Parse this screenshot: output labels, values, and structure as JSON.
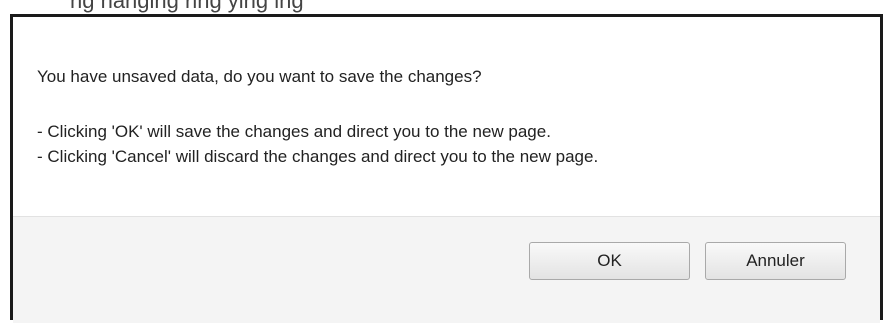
{
  "background_header": {
    "text": "ng  hanging  ring  ying  ing"
  },
  "dialog": {
    "message": "You have unsaved data, do you want to save the changes?",
    "detail_lines": [
      "- Clicking 'OK' will save the changes and direct you to the new page.",
      "- Clicking 'Cancel' will discard the changes and direct you to the new page."
    ],
    "buttons": {
      "ok_label": "OK",
      "cancel_label": "Annuler"
    }
  },
  "colors": {
    "border": "#1a1a1a",
    "footer_bg": "#f4f4f4",
    "body_bg": "#ffffff"
  }
}
